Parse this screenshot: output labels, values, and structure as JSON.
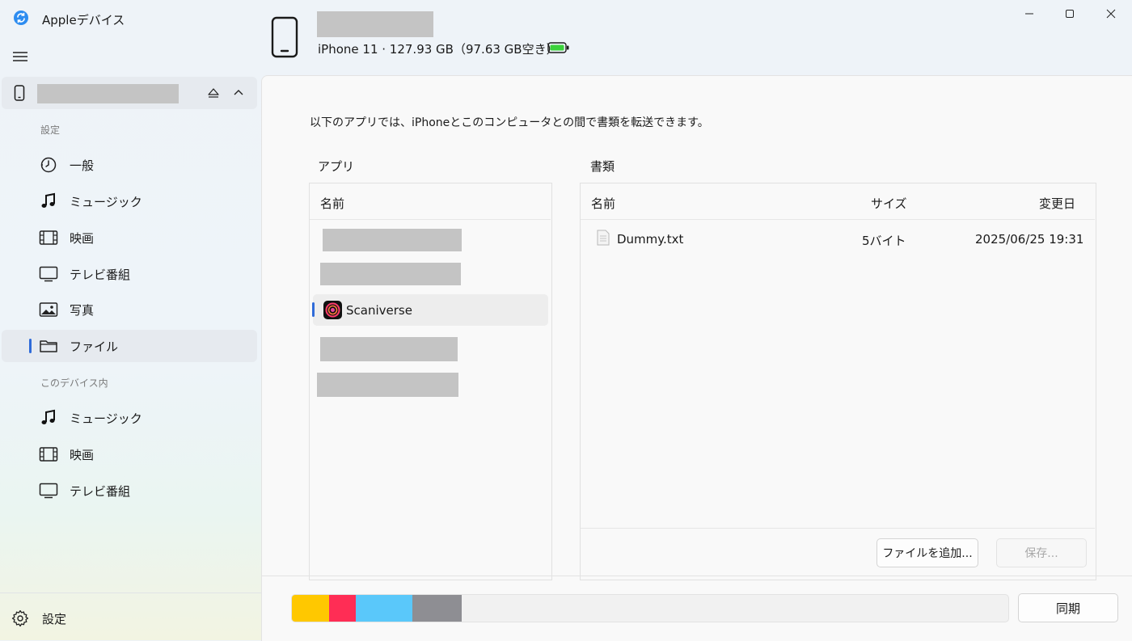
{
  "app": {
    "title": "Appleデバイス"
  },
  "device": {
    "info": "iPhone 11 · 127.93 GB（97.63 GB空き）"
  },
  "sidebar": {
    "settings_section": "設定",
    "settings_items": [
      {
        "label": "一般",
        "icon": "clock-gear-icon"
      },
      {
        "label": "ミュージック",
        "icon": "music-note-icon"
      },
      {
        "label": "映画",
        "icon": "film-icon"
      },
      {
        "label": "テレビ番組",
        "icon": "tv-icon"
      },
      {
        "label": "写真",
        "icon": "photo-icon"
      },
      {
        "label": "ファイル",
        "icon": "folder-icon"
      }
    ],
    "device_section": "このデバイス内",
    "device_items": [
      {
        "label": "ミュージック",
        "icon": "music-note-icon"
      },
      {
        "label": "映画",
        "icon": "film-icon"
      },
      {
        "label": "テレビ番組",
        "icon": "tv-icon"
      }
    ],
    "settings_label": "設定"
  },
  "main": {
    "intro": "以下のアプリでは、iPhoneとこのコンピュータとの間で書類を転送できます。",
    "apps_label": "アプリ",
    "docs_label": "書類",
    "apps_column": "名前",
    "selected_app": "Scaniverse",
    "docs_columns": {
      "name": "名前",
      "size": "サイズ",
      "modified": "変更日"
    },
    "documents": [
      {
        "name": "Dummy.txt",
        "size": "5バイト",
        "modified": "2025/06/25 19:31"
      }
    ],
    "add_file_button": "ファイルを追加...",
    "save_button": "保存..."
  },
  "footer": {
    "sync_button": "同期",
    "storage_colors": [
      "#ffc800",
      "#ff2d55",
      "#5ac8fa",
      "#8e8e93"
    ]
  }
}
